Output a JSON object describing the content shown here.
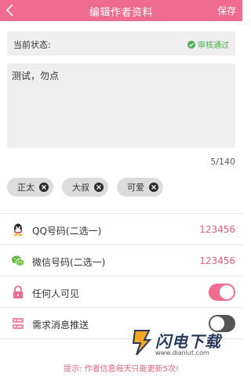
{
  "header": {
    "title": "编辑作者资料",
    "save_label": "保存",
    "back_icon": "chevron-left-icon"
  },
  "status": {
    "label": "当前状态:",
    "value": "审核通过",
    "icon": "check-circle-icon",
    "color": "#4caf50"
  },
  "intro": {
    "text": "测试，勿点",
    "counter": "5/140"
  },
  "tags": [
    {
      "label": "正太"
    },
    {
      "label": "大叔"
    },
    {
      "label": "可爱"
    }
  ],
  "rows": {
    "qq": {
      "label": "QQ号码(二选一)",
      "value": "123456",
      "icon": "qq-icon"
    },
    "wechat": {
      "label": "微信号码(二选一)",
      "value": "123456",
      "icon": "wechat-icon"
    },
    "visibility": {
      "label": "任何人可见",
      "icon": "lock-icon",
      "enabled": true
    },
    "push": {
      "label": "需求消息推送",
      "icon": "list-icon",
      "enabled": false
    }
  },
  "hint": "提示: 作者信息每天只能更新5次!",
  "watermark": {
    "name": "闪电下载",
    "url": "www.dianlut.com"
  },
  "colors": {
    "accent": "#ef6b8f",
    "value_text": "#e9607e",
    "success": "#4caf50"
  }
}
